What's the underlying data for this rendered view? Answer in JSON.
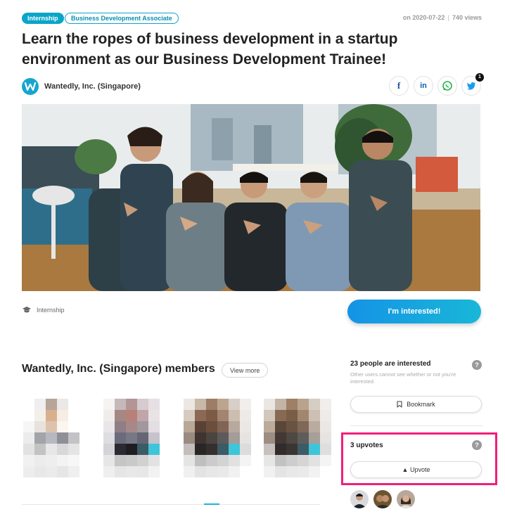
{
  "tags": {
    "type": "Internship",
    "role": "Business Development Associate"
  },
  "meta": {
    "date": "on 2020-07-22",
    "views": "740 views"
  },
  "title": "Learn the ropes of business development in a startup environment as our Business Development Trainee!",
  "company": {
    "name": "Wantedly, Inc. (Singapore)",
    "logo_letter": "W",
    "brand_color": "#16a5d0"
  },
  "share": {
    "facebook": "f",
    "linkedin": "in",
    "whatsapp": "whatsapp-icon",
    "twitter": "twitter-icon",
    "twitter_count": "1"
  },
  "job_type": {
    "label": "Internship",
    "icon": "graduation-cap-icon"
  },
  "cta": {
    "interested_label": "I'm interested!"
  },
  "members": {
    "title": "Wantedly, Inc. (Singapore) members",
    "view_more": "View more"
  },
  "interest_panel": {
    "count_text": "23 people are interested",
    "note": "Other users cannot see whether or not you're interested.",
    "help": "?",
    "bookmark_label": "Bookmark"
  },
  "upvote_panel": {
    "count_text": "3 upvotes",
    "help": "?",
    "upvote_label": "▲ Upvote"
  },
  "colors": {
    "accent": "#0aa5c8",
    "highlight": "#f01f7a"
  }
}
